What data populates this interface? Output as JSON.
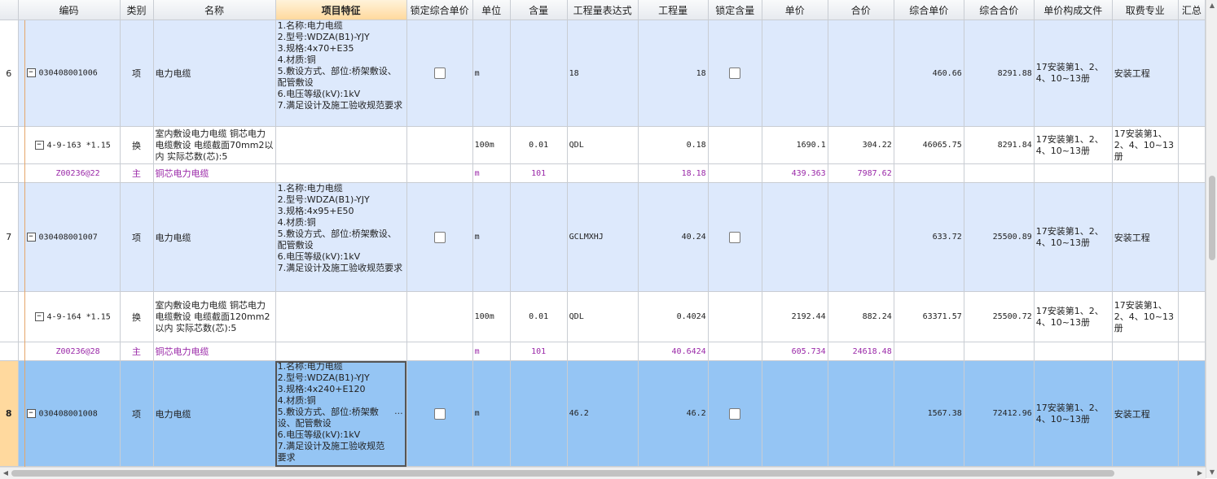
{
  "headers": [
    "",
    "编码",
    "类别",
    "名称",
    "项目特征",
    "锁定综合单价",
    "单位",
    "含量",
    "工程量表达式",
    "工程量",
    "锁定含量",
    "单价",
    "合价",
    "综合单价",
    "综合合价",
    "单价构成文件",
    "取费专业",
    "汇总"
  ],
  "rows": [
    {
      "rn": "6",
      "code": "030408001006",
      "type": "项",
      "name": "电力电缆",
      "feature": "1.名称:电力电缆\n2.型号:WDZA(B1)-YJY\n3.规格:4x70+E35\n4.材质:铜\n5.敷设方式、部位:桥架敷设、配管敷设\n6.电压等级(kV):1kV\n7.满足设计及施工验收规范要求",
      "unit": "m",
      "content": "",
      "expr": "18",
      "qty": "18",
      "price": "",
      "amount": "",
      "cprice": "460.66",
      "camount": "8291.88",
      "file": "17安装第1、2、4、10~13册",
      "major": "安装工程"
    },
    {
      "rn": "",
      "code": "4-9-163 *1.15",
      "type": "换",
      "name": "室内敷设电力电缆 铜芯电力电缆敷设 电缆截面70mm2以内  实际芯数(芯):5",
      "feature": "",
      "unit": "100m",
      "content": "0.01",
      "expr": "QDL",
      "qty": "0.18",
      "price": "1690.1",
      "amount": "304.22",
      "cprice": "46065.75",
      "camount": "8291.84",
      "file": "17安装第1、2、4、10~13册",
      "major": "17安装第1、2、4、10~13册"
    },
    {
      "rn": "",
      "code": "Z00236@22",
      "type": "主",
      "name": "铜芯电力电缆",
      "feature": "",
      "unit": "m",
      "content": "101",
      "expr": "",
      "qty": "18.18",
      "price": "439.363",
      "amount": "7987.62",
      "cprice": "",
      "camount": "",
      "file": "",
      "major": ""
    },
    {
      "rn": "7",
      "code": "030408001007",
      "type": "项",
      "name": "电力电缆",
      "feature": "1.名称:电力电缆\n2.型号:WDZA(B1)-YJY\n3.规格:4x95+E50\n4.材质:铜\n5.敷设方式、部位:桥架敷设、配管敷设\n6.电压等级(kV):1kV\n7.满足设计及施工验收规范要求",
      "unit": "m",
      "content": "",
      "expr": "GCLMXHJ",
      "qty": "40.24",
      "price": "",
      "amount": "",
      "cprice": "633.72",
      "camount": "25500.89",
      "file": "17安装第1、2、4、10~13册",
      "major": "安装工程"
    },
    {
      "rn": "",
      "code": "4-9-164 *1.15",
      "type": "换",
      "name": "室内敷设电力电缆 铜芯电力电缆敷设 电缆截面120mm2以内  实际芯数(芯):5",
      "feature": "",
      "unit": "100m",
      "content": "0.01",
      "expr": "QDL",
      "qty": "0.4024",
      "price": "2192.44",
      "amount": "882.24",
      "cprice": "63371.57",
      "camount": "25500.72",
      "file": "17安装第1、2、4、10~13册",
      "major": "17安装第1、2、4、10~13册"
    },
    {
      "rn": "",
      "code": "Z00236@28",
      "type": "主",
      "name": "铜芯电力电缆",
      "feature": "",
      "unit": "m",
      "content": "101",
      "expr": "",
      "qty": "40.6424",
      "price": "605.734",
      "amount": "24618.48",
      "cprice": "",
      "camount": "",
      "file": "",
      "major": ""
    },
    {
      "rn": "8",
      "code": "030408001008",
      "type": "项",
      "name": "电力电缆",
      "feature": "1.名称:电力电缆\n2.型号:WDZA(B1)-YJY\n3.规格:4x240+E120\n4.材质:铜\n5.敷设方式、部位:桥架敷设、配管敷设\n6.电压等级(kV):1kV\n7.满足设计及施工验收规范要求",
      "unit": "m",
      "content": "",
      "expr": "46.2",
      "qty": "46.2",
      "price": "",
      "amount": "",
      "cprice": "1567.38",
      "camount": "72412.96",
      "file": "17安装第1、2、4、10~13册",
      "major": "安装工程"
    }
  ],
  "tree_toggle": "−",
  "feature_more": "···",
  "icons": {
    "collapse": "minus-box-icon",
    "more": "ellipsis-icon"
  },
  "colors": {
    "item_row": "#dde9fc",
    "selected_row": "#95c5f4",
    "material_text": "#9a28a8",
    "active_header": "#ffd99e"
  }
}
